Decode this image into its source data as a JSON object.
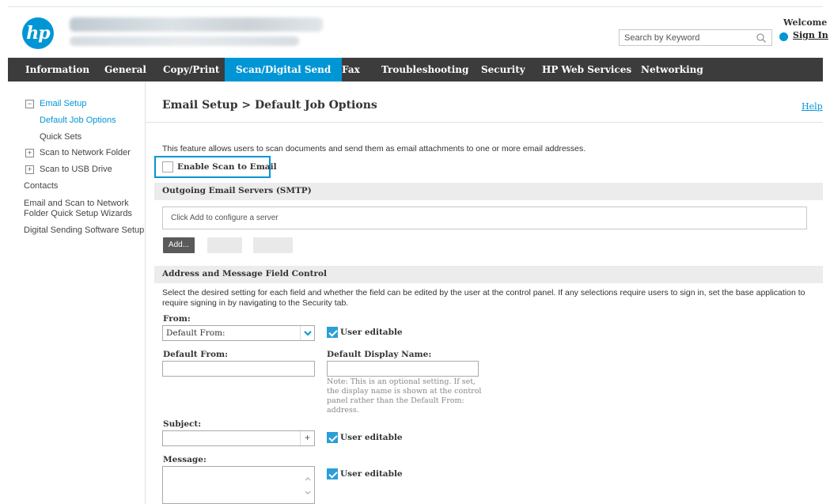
{
  "header": {
    "logo_text": "hp",
    "search_placeholder": "Search by Keyword",
    "welcome": "Welcome",
    "sign_in": "Sign In"
  },
  "nav": {
    "tabs": [
      {
        "label": "Information"
      },
      {
        "label": "General"
      },
      {
        "label": "Copy/Print"
      },
      {
        "label": "Scan/Digital Send",
        "active": true
      },
      {
        "label": "Fax"
      },
      {
        "label": "Troubleshooting"
      },
      {
        "label": "Security"
      },
      {
        "label": "HP Web Services"
      },
      {
        "label": "Networking"
      }
    ]
  },
  "sidebar": {
    "items": [
      {
        "label": "Email Setup",
        "toggle": "−"
      },
      {
        "label": "Default Job Options"
      },
      {
        "label": "Quick Sets"
      },
      {
        "label": "Scan to Network Folder",
        "toggle": "+"
      },
      {
        "label": "Scan to USB Drive",
        "toggle": "+"
      },
      {
        "label": "Contacts"
      },
      {
        "label": "Email and Scan to Network"
      },
      {
        "label": "Folder Quick Setup Wizards"
      },
      {
        "label": "Digital Sending Software Setup"
      }
    ]
  },
  "main": {
    "title": "Email Setup > Default Job Options",
    "help": "Help",
    "description": "This feature allows users to scan documents and send them as email attachments to one or more email addresses.",
    "enable_label": "Enable Scan to Email",
    "smtp_section": "Outgoing Email Servers (SMTP)",
    "server_hint": "Click Add to configure a server",
    "add_button": "Add...",
    "address_section": "Address and Message Field Control",
    "field_description": "Select the desired setting for each field and whether the field can be edited by the user at the control panel. If any selections require users to sign in, set the base application to require signing in by navigating to the Security tab.",
    "from_label": "From:",
    "from_value": "Default From:",
    "user_editable": "User editable",
    "default_from_label": "Default From:",
    "default_display_name_label": "Default Display Name:",
    "note": "Note: This is an optional setting. If set, the display name is shown at the control panel rather than the Default From: address.",
    "subject_label": "Subject:",
    "message_label": "Message:"
  },
  "colors": {
    "accent": "#0096d6",
    "navbar": "#3c3c3c"
  }
}
